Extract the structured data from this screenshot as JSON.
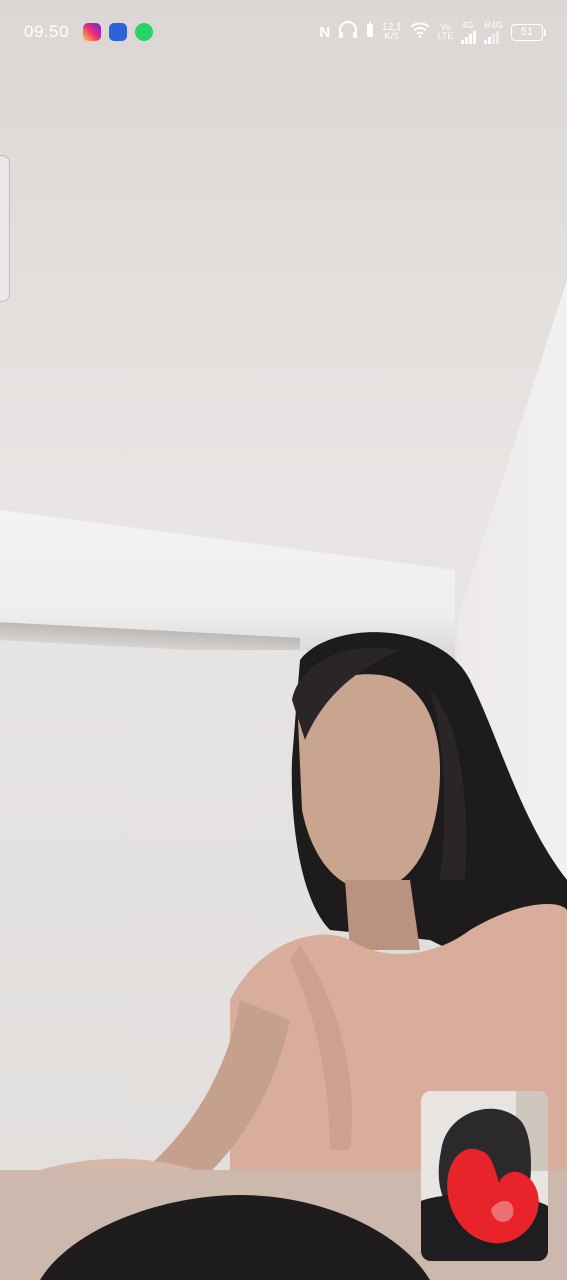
{
  "status_bar": {
    "time": "09.50",
    "notification_icons": [
      "instagram-icon",
      "app-icon",
      "whatsapp-icon"
    ],
    "nfc": "N",
    "network_speed_value": "12,1",
    "network_speed_unit": "K/S",
    "volte_top": "Vo",
    "volte_bottom": "LTE",
    "sim1_label": "4G",
    "sim2_label": "R4G",
    "battery": "51"
  },
  "call": {
    "remote_video": "remote-video-feed",
    "self_preview": "self-video-preview",
    "colors": {
      "status_text": "#ffffff",
      "self_preview_markup": "#e8242a"
    }
  }
}
